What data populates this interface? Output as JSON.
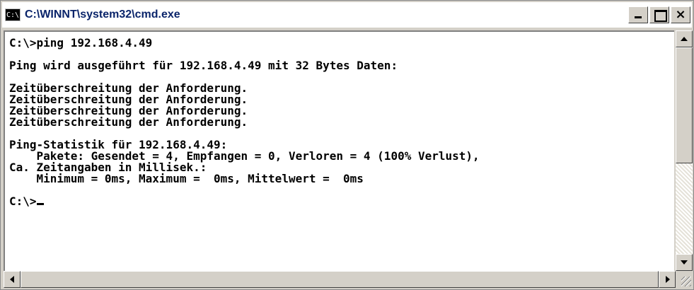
{
  "window": {
    "title": "C:\\WINNT\\system32\\cmd.exe",
    "icon": "cmd-icon",
    "icon_text": "C:\\",
    "buttons": {
      "minimize": "minimize-icon",
      "maximize": "maximize-icon",
      "close": "×"
    }
  },
  "console": {
    "lines": [
      "C:\\>ping 192.168.4.49",
      "",
      "Ping wird ausgeführt für 192.168.4.49 mit 32 Bytes Daten:",
      "",
      "Zeitüberschreitung der Anforderung.",
      "Zeitüberschreitung der Anforderung.",
      "Zeitüberschreitung der Anforderung.",
      "Zeitüberschreitung der Anforderung.",
      "",
      "Ping-Statistik für 192.168.4.49:",
      "    Pakete: Gesendet = 4, Empfangen = 0, Verloren = 4 (100% Verlust),",
      "Ca. Zeitangaben in Millisek.:",
      "    Minimum = 0ms, Maximum =  0ms, Mittelwert =  0ms",
      "",
      "C:\\>"
    ]
  },
  "colors": {
    "console_bg": "#ffffff",
    "console_text": "#000000",
    "title_text": "#0a246a",
    "chrome": "#d4d0c8"
  }
}
